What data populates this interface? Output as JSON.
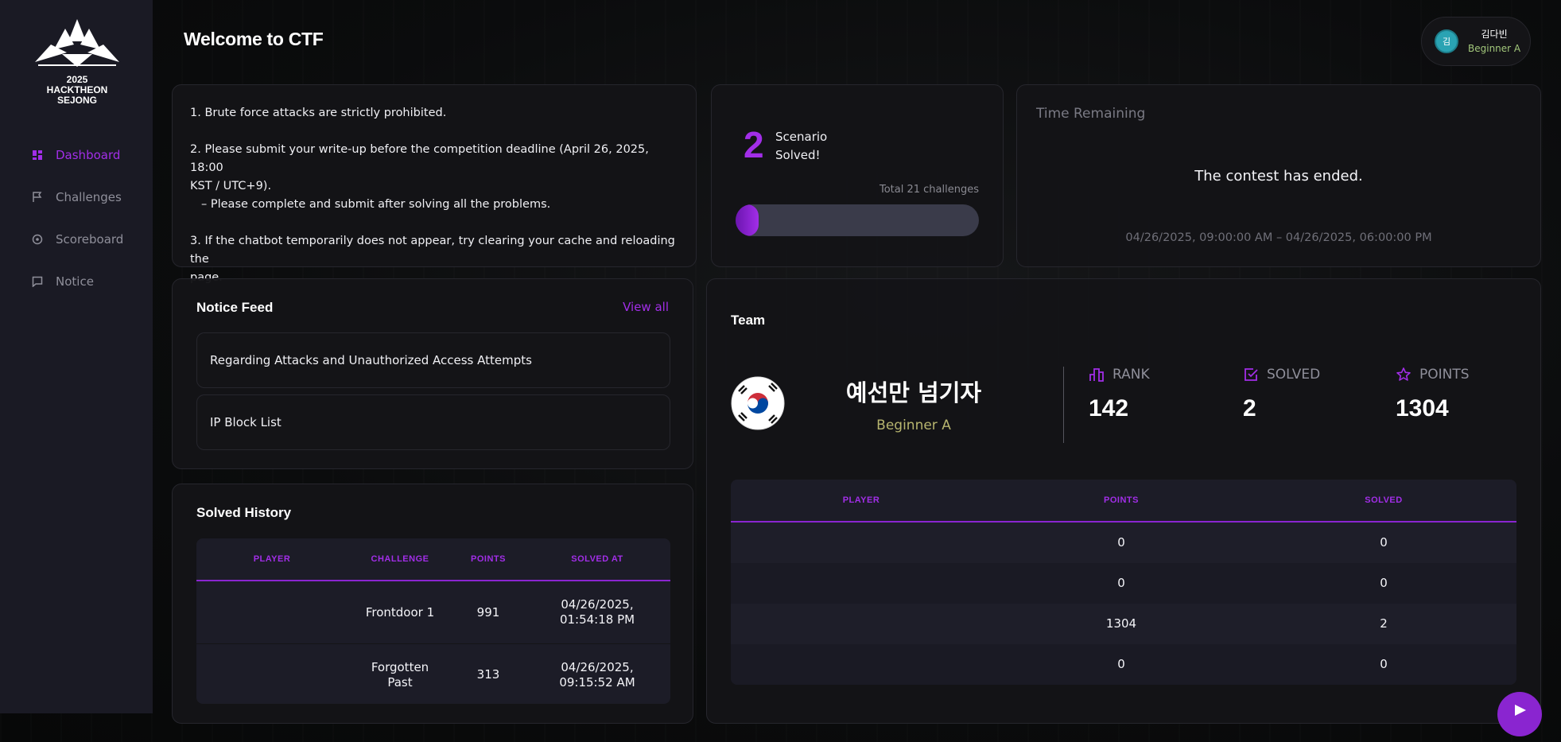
{
  "brand": {
    "logo_text_line1": "2025",
    "logo_text_line2": "HACKTHEON",
    "logo_text_line3": "SEJONG",
    "accent": "#a22ee8"
  },
  "sidebar": {
    "items": [
      {
        "label": "Dashboard",
        "icon": "dashboard-icon",
        "active": true
      },
      {
        "label": "Challenges",
        "icon": "flag-icon",
        "active": false
      },
      {
        "label": "Scoreboard",
        "icon": "scoreboard-icon",
        "active": false
      },
      {
        "label": "Notice",
        "icon": "message-icon",
        "active": false
      }
    ]
  },
  "header": {
    "title": "Welcome to CTF"
  },
  "user": {
    "avatar_initial": "김",
    "name": "김다빈",
    "tier": "Beginner A"
  },
  "rules": {
    "line1": "1. Brute force attacks are strictly prohibited.",
    "line2a": "2. Please submit your write-up before the competition deadline (April 26, 2025, 18:00",
    "line2b": "KST / UTC+9).",
    "line2c": "– Please complete and submit after solving all the problems.",
    "line3a": "3. If the chatbot temporarily does not appear, try clearing your cache and reloading the",
    "line3b": "page."
  },
  "progress": {
    "solved_count": "2",
    "solved_label_line1": "Scenario",
    "solved_label_line2": "Solved!",
    "total_label": "Total 21 challenges",
    "fraction": 0.095
  },
  "time": {
    "title": "Time Remaining",
    "status": "The contest has ended.",
    "range": "04/26/2025, 09:00:00 AM  –  04/26/2025, 06:00:00 PM"
  },
  "notice_feed": {
    "title": "Notice Feed",
    "view_all": "View all",
    "items": [
      "Regarding Attacks and Unauthorized Access Attempts",
      "IP Block List"
    ]
  },
  "solved_history": {
    "title": "Solved History",
    "columns": [
      "PLAYER",
      "CHALLENGE",
      "POINTS",
      "SOLVED AT"
    ],
    "rows": [
      {
        "player": "",
        "challenge": "Frontdoor 1",
        "points": "991",
        "solved_at_line1": "04/26/2025,",
        "solved_at_line2": "01:54:18 PM"
      },
      {
        "player": "",
        "challenge_line1": "Forgotten",
        "challenge_line2": "Past",
        "points": "313",
        "solved_at_line1": "04/26/2025,",
        "solved_at_line2": "09:15:52 AM"
      }
    ]
  },
  "team": {
    "title": "Team",
    "name": "예선만 넘기자",
    "tier": "Beginner A",
    "stats": [
      {
        "label": "RANK",
        "icon": "rank-icon",
        "value": "142"
      },
      {
        "label": "SOLVED",
        "icon": "checkbox-icon",
        "value": "2"
      },
      {
        "label": "POINTS",
        "icon": "star-icon",
        "value": "1304"
      }
    ],
    "columns": [
      "PLAYER",
      "POINTS",
      "SOLVED"
    ],
    "rows": [
      {
        "player": "",
        "points": "0",
        "solved": "0"
      },
      {
        "player": "",
        "points": "0",
        "solved": "0"
      },
      {
        "player": "",
        "points": "1304",
        "solved": "2"
      },
      {
        "player": "",
        "points": "0",
        "solved": "0"
      }
    ]
  }
}
